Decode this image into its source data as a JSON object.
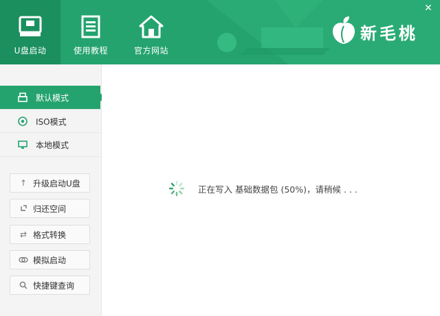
{
  "window": {
    "close_label": "✕"
  },
  "header": {
    "tabs": [
      {
        "label": "U盘启动",
        "icon": "usb-drive-icon",
        "active": true
      },
      {
        "label": "使用教程",
        "icon": "document-icon",
        "active": false
      },
      {
        "label": "官方网站",
        "icon": "home-icon",
        "active": false
      }
    ],
    "brand": {
      "name": "新毛桃",
      "icon": "peach-logo-icon"
    },
    "colors": {
      "primary": "#25a36f",
      "active_tab": "#1b8f5e"
    }
  },
  "sidebar": {
    "modes": [
      {
        "label": "默认模式",
        "icon": "usb-stick-icon",
        "active": true
      },
      {
        "label": "ISO模式",
        "icon": "disc-icon",
        "active": false
      },
      {
        "label": "本地模式",
        "icon": "monitor-icon",
        "active": false
      }
    ],
    "tools": [
      {
        "label": "升级启动U盘",
        "icon": "arrow-up-icon"
      },
      {
        "label": "归还空间",
        "icon": "restore-icon"
      },
      {
        "label": "格式转换",
        "icon": "swap-arrows-icon"
      },
      {
        "label": "模拟启动",
        "icon": "link-icon"
      },
      {
        "label": "快捷键查询",
        "icon": "search-icon"
      }
    ]
  },
  "main": {
    "status_text": "正在写入 基础数据包 (50%)，请稍候 . . .",
    "progress_percent": 50
  }
}
